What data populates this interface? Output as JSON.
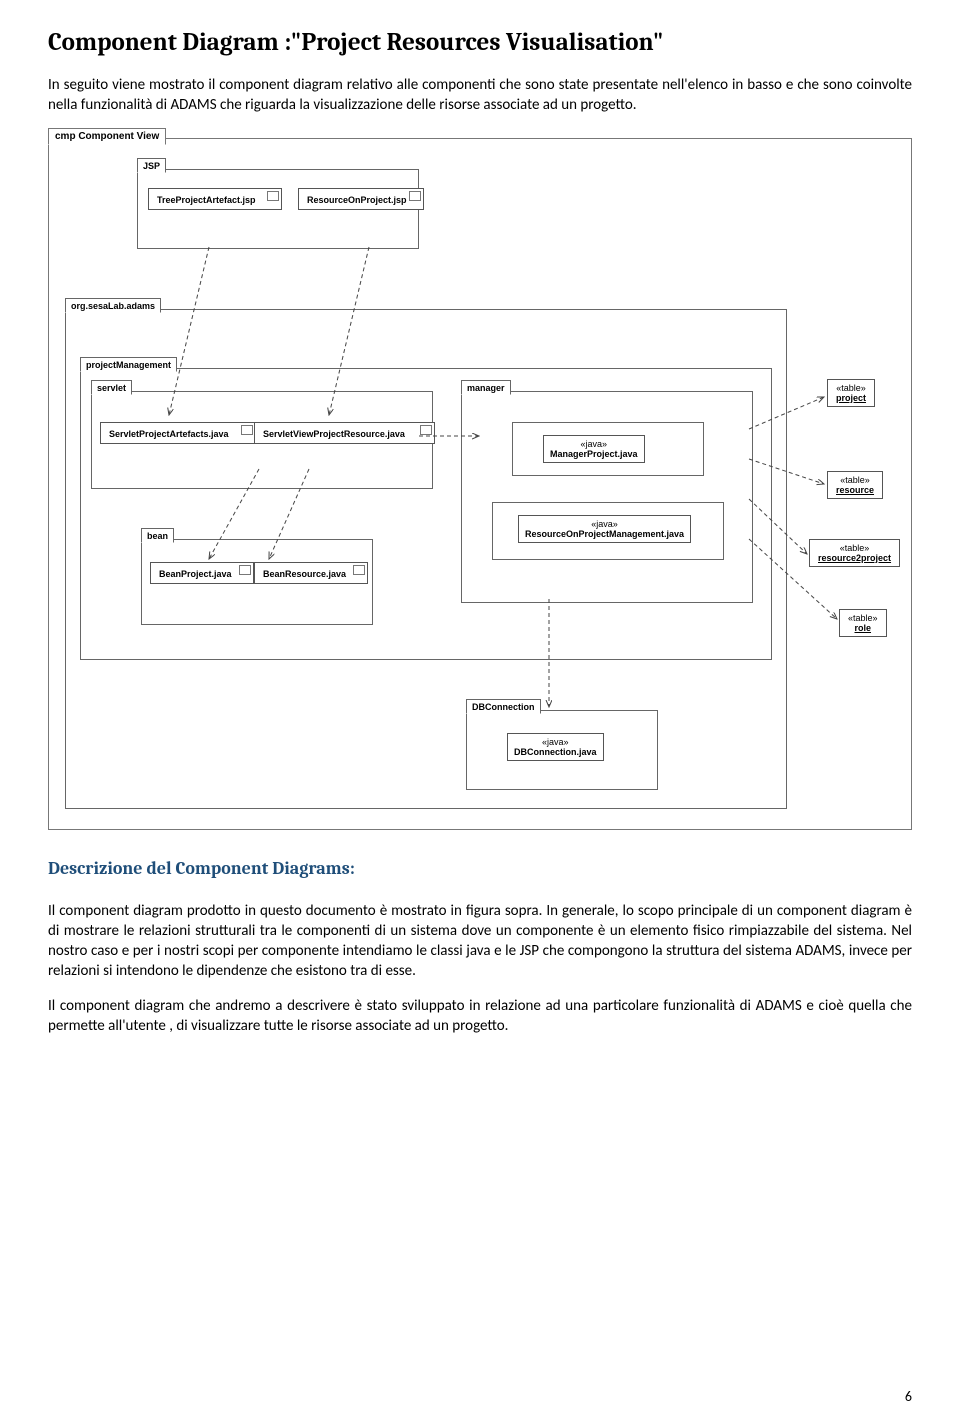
{
  "title": "Component Diagram :\"Project Resources Visualisation\"",
  "intro": "In seguito viene mostrato il component diagram relativo alle componenti che sono state presentate nell'elenco in basso e che sono coinvolte nella funzionalità di ADAMS che riguarda la visualizzazione delle risorse associate ad un progetto.",
  "diagram": {
    "tab": "cmp Component View",
    "jsp": {
      "label": "JSP",
      "c1": "TreeProjectArtefact.jsp",
      "c2": "ResourceOnProject.jsp"
    },
    "adams": {
      "label": "org.sesaLab.adams",
      "pm": {
        "label": "projectManagement",
        "servlet": {
          "label": "servlet",
          "c1": "ServletProjectArtefacts.java",
          "c2": "ServletViewProjectResource.java"
        },
        "bean": {
          "label": "bean",
          "c1": "BeanProject.java",
          "c2": "BeanResource.java"
        },
        "manager": {
          "label": "manager",
          "j1s": "«java»",
          "j1": "ManagerProject.java",
          "j2s": "«java»",
          "j2": "ResourceOnProjectManagement.java"
        }
      },
      "dbc": {
        "label": "DBConnection",
        "js": "«java»",
        "jn": "DBConnection.java"
      }
    },
    "tables": {
      "s": "«table»",
      "t1": "project",
      "t2": "resource",
      "t3": "resource2project",
      "t4": "role"
    }
  },
  "sub": "Descrizione del Component Diagrams:",
  "p1": "Il component diagram prodotto in questo documento è mostrato in figura sopra. In generale, lo scopo principale di un component diagram è di mostrare le relazioni strutturali tra le componenti di un sistema dove un componente è un elemento fisico rimpiazzabile del sistema. Nel nostro caso e per i nostri scopi per componente intendiamo le classi java e le JSP che compongono la struttura del sistema ADAMS, invece per relazioni si intendono le dipendenze che esistono tra di esse.",
  "p2": "Il component diagram che andremo a descrivere è stato sviluppato in relazione ad una particolare funzionalità di ADAMS e cioè quella che permette all'utente , di visualizzare tutte le risorse associate ad un progetto.",
  "pagenum": "6"
}
